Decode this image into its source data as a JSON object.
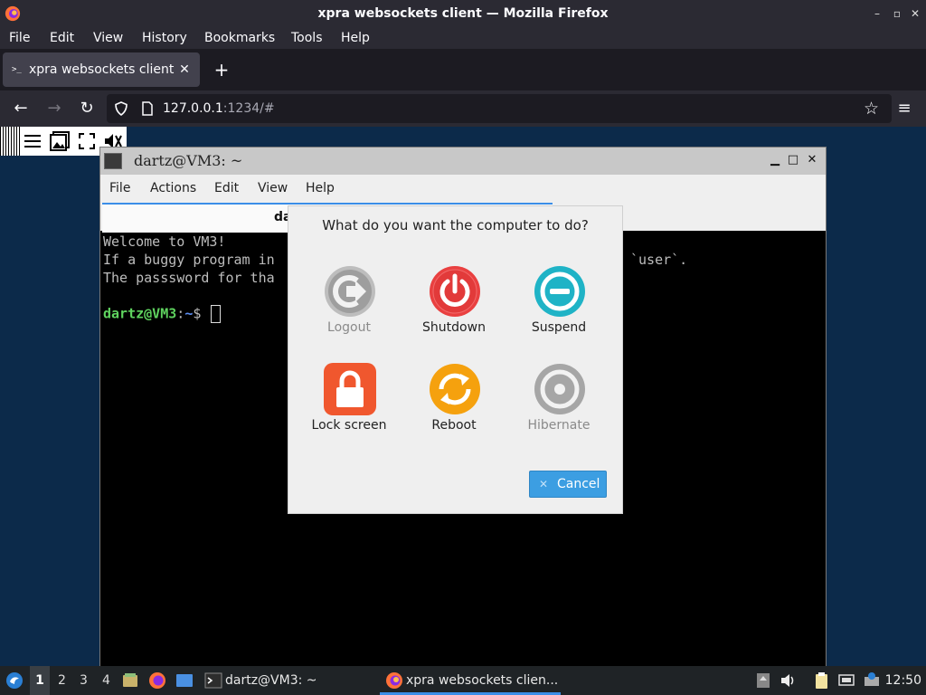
{
  "firefox": {
    "window_title": "xpra websockets client — Mozilla Firefox",
    "menu": [
      "File",
      "Edit",
      "View",
      "History",
      "Bookmarks",
      "Tools",
      "Help"
    ],
    "tab": {
      "title": "xpra websockets client"
    },
    "url": {
      "host": "127.0.0.1",
      "rest": ":1234/#"
    }
  },
  "xpra_window": {
    "title": "dartz@VM3: ~",
    "menu": [
      "File",
      "Actions",
      "Edit",
      "View",
      "Help"
    ],
    "tab_label": "da",
    "terminal_lines": [
      "Welcome to VM3!",
      "If a buggy program in",
      "The passsword for tha"
    ],
    "terminal_right_fragment": "`user`.",
    "prompt": {
      "user": "dartz@VM3",
      "path": "~",
      "symbol": "$"
    }
  },
  "dialog": {
    "question": "What do you want the computer to do?",
    "options": [
      {
        "label": "Logout",
        "icon": "logout-icon",
        "enabled": false
      },
      {
        "label": "Shutdown",
        "icon": "shutdown-icon",
        "enabled": true
      },
      {
        "label": "Suspend",
        "icon": "suspend-icon",
        "enabled": true
      },
      {
        "label": "Lock screen",
        "icon": "lock-icon",
        "enabled": true
      },
      {
        "label": "Reboot",
        "icon": "reboot-icon",
        "enabled": true
      },
      {
        "label": "Hibernate",
        "icon": "hibernate-icon",
        "enabled": false
      }
    ],
    "cancel_label": "Cancel"
  },
  "taskbar": {
    "workspaces": [
      "1",
      "2",
      "3",
      "4"
    ],
    "tasks": [
      {
        "label": "dartz@VM3: ~",
        "icon": "terminal-icon"
      },
      {
        "label": "xpra websockets clien...",
        "icon": "firefox-icon"
      }
    ],
    "clock": "12:50"
  },
  "colors": {
    "accent": "#3b8ee8",
    "shutdown": "#e94040",
    "suspend": "#1fb3c6",
    "lock": "#f0572e",
    "reboot": "#f5a10e",
    "disabled": "#9e9e9e"
  }
}
